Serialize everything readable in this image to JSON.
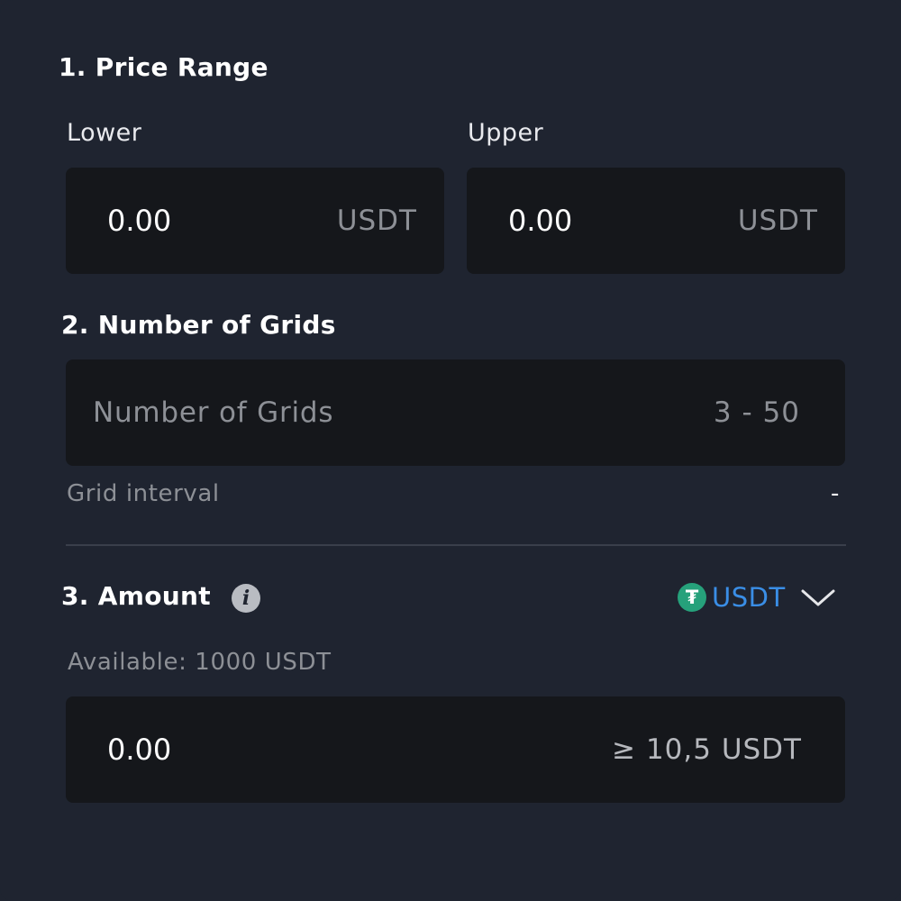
{
  "price_range": {
    "title": "1. Price Range",
    "lower": {
      "label": "Lower",
      "value": "0.00",
      "unit": "USDT"
    },
    "upper": {
      "label": "Upper",
      "value": "0.00",
      "unit": "USDT"
    }
  },
  "grids": {
    "title": "2. Number of Grids",
    "placeholder": "Number of Grids",
    "range": "3 - 50",
    "interval_label": "Grid interval",
    "interval_value": "-"
  },
  "amount": {
    "title": "3. Amount",
    "info_icon": "i",
    "currency": "USDT",
    "currency_icon_glyph": "₮",
    "available": "Available: 1000 USDT",
    "value": "0.00",
    "min_hint": "≥ 10,5 USDT"
  },
  "colors": {
    "background": "#1f2430",
    "input_background": "#15171b",
    "accent_blue": "#3a8ee6",
    "tether_green": "#26a17b",
    "muted_text": "#8d9096"
  },
  "icons": [
    "info-icon",
    "tether-icon",
    "chevron-down-icon"
  ]
}
